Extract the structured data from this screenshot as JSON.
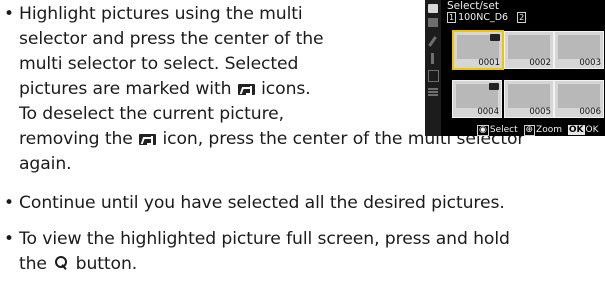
{
  "bullets": [
    {
      "lines": [
        "Highlight pictures using the multi",
        "selector and press the center of the",
        "multi selector to select. Selected",
        [
          "pictures are marked with ",
          "icon",
          " icons."
        ],
        "To deselect the current picture,",
        [
          "removing the ",
          "icon",
          " icon, press the center of the multi selector"
        ],
        "again."
      ]
    },
    {
      "lines": [
        "Continue until you have selected all the desired pictures."
      ]
    },
    {
      "lines": [
        "To view the highlighted picture full screen, press and hold",
        [
          "the ",
          "zoom",
          " button."
        ]
      ]
    }
  ],
  "p1": {
    "l1": "Highlight pictures using the multi",
    "l2": "selector and press the center of the",
    "l3": "multi selector to select. Selected",
    "l4a": "pictures are marked with ",
    "l4b": " icons.",
    "l5": "To deselect the current picture,",
    "l6a": "removing the ",
    "l6b": " icon, press the center of the multi selector",
    "l7": "again."
  },
  "p2": {
    "l1": "Continue until you have selected all the desired pictures."
  },
  "p3": {
    "l1": "To view the highlighted picture full screen, press and hold",
    "l2a": "the ",
    "l2b": " button."
  },
  "bullet_char": "•",
  "screen": {
    "title": "Select/set",
    "folder_index": "1",
    "folder": "100NC_D6",
    "count_badge": "2",
    "thumbs": [
      {
        "num": "0001",
        "selected": true,
        "marked": true
      },
      {
        "num": "0002",
        "selected": false,
        "marked": false
      },
      {
        "num": "0003",
        "selected": false,
        "marked": false
      },
      {
        "num": "0004",
        "selected": false,
        "marked": true
      },
      {
        "num": "0005",
        "selected": false,
        "marked": false
      },
      {
        "num": "0006",
        "selected": false,
        "marked": false
      }
    ],
    "footer": {
      "select": "Select",
      "zoom": "Zoom",
      "ok_key": "OK",
      "ok": "OK"
    }
  }
}
